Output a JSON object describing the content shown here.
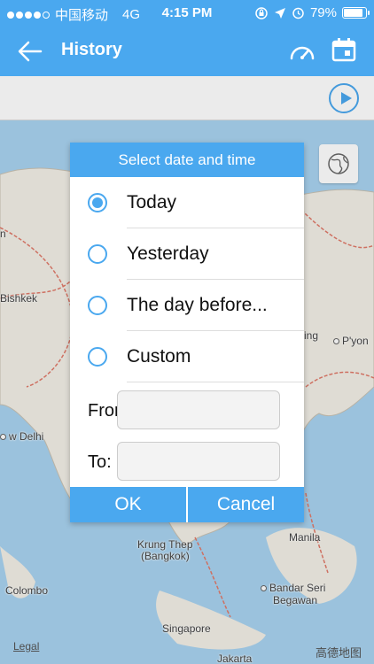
{
  "status_bar": {
    "carrier": "中国移动",
    "network": "4G",
    "time": "4:15 PM",
    "battery_percent": "79%",
    "battery_level": 0.79
  },
  "nav": {
    "title": "History",
    "icons": [
      "back-arrow-icon",
      "speedometer-icon",
      "calendar-icon"
    ]
  },
  "map": {
    "cities": [
      {
        "name": "Bishkek"
      },
      {
        "name": "w Delhi"
      },
      {
        "name": "ing"
      },
      {
        "name": "P'yon"
      },
      {
        "name": "Krung Thep"
      },
      {
        "name": "(Bangkok)"
      },
      {
        "name": "Manila"
      },
      {
        "name": "Colombo"
      },
      {
        "name": "Bandar Seri"
      },
      {
        "name": "Begawan"
      },
      {
        "name": "Singapore"
      },
      {
        "name": "Jakarta"
      },
      {
        "name": "n"
      }
    ],
    "legal": "Legal",
    "watermark": "高德地图"
  },
  "dialog": {
    "title": "Select date and time",
    "options": [
      {
        "label": "Today",
        "checked": true
      },
      {
        "label": "Yesterday",
        "checked": false
      },
      {
        "label": "The day before...",
        "checked": false
      },
      {
        "label": "Custom",
        "checked": false
      }
    ],
    "from_label": "From:",
    "from_value": "",
    "to_label": "To:",
    "to_value": "",
    "ok_label": "OK",
    "cancel_label": "Cancel"
  },
  "colors": {
    "accent": "#4aa8ef",
    "map_water": "#a9d3f0",
    "map_land": "#f2efe6",
    "border_line": "#e07a6a"
  }
}
